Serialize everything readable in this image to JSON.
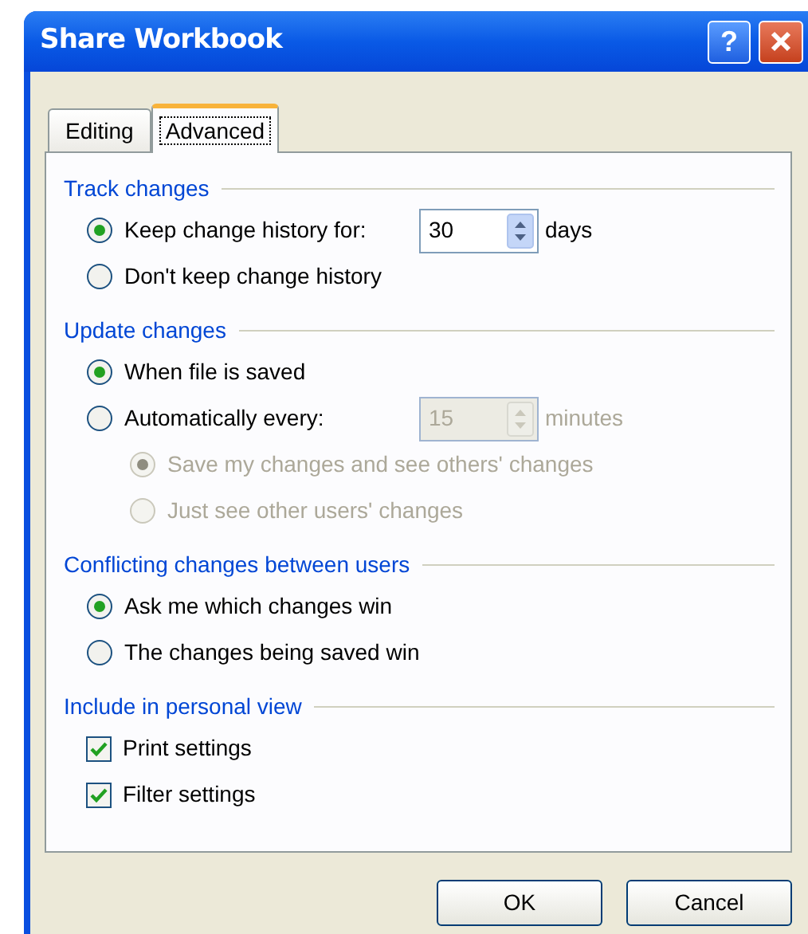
{
  "window": {
    "title": "Share Workbook",
    "buttons": [
      {
        "kind": "help",
        "label": "?"
      },
      {
        "kind": "close"
      }
    ]
  },
  "tabs": [
    {
      "label": "Editing",
      "selected": false
    },
    {
      "label": "Advanced",
      "selected": true
    }
  ],
  "sections": [
    {
      "title": "Track changes",
      "items": [
        {
          "kind": "radio",
          "label": "Keep change history for:",
          "selected": true,
          "disabled": false,
          "spin": {
            "value": "30",
            "disabled": false
          },
          "suffix": "days"
        },
        {
          "kind": "radio",
          "label": "Don't keep change history",
          "selected": false,
          "disabled": false
        }
      ]
    },
    {
      "title": "Update changes",
      "items": [
        {
          "kind": "radio",
          "label": "When file is saved",
          "selected": true,
          "disabled": false
        },
        {
          "kind": "radio",
          "label": "Automatically every:",
          "selected": false,
          "disabled": false,
          "spin": {
            "value": "15",
            "disabled": true
          },
          "suffix": "minutes",
          "children": [
            {
              "kind": "radio",
              "label": "Save my changes and see others' changes",
              "selected": true,
              "disabled": true
            },
            {
              "kind": "radio",
              "label": "Just see other users' changes",
              "selected": false,
              "disabled": true
            }
          ]
        }
      ]
    },
    {
      "title": "Conflicting changes between users",
      "items": [
        {
          "kind": "radio",
          "label": "Ask me which changes win",
          "selected": true,
          "disabled": false
        },
        {
          "kind": "radio",
          "label": "The changes being saved win",
          "selected": false,
          "disabled": false
        }
      ]
    },
    {
      "title": "Include in personal view",
      "items": [
        {
          "kind": "checkbox",
          "label": "Print settings",
          "checked": true,
          "disabled": false
        },
        {
          "kind": "checkbox",
          "label": "Filter settings",
          "checked": true,
          "disabled": false
        }
      ]
    }
  ],
  "buttons": [
    "OK",
    "Cancel"
  ]
}
